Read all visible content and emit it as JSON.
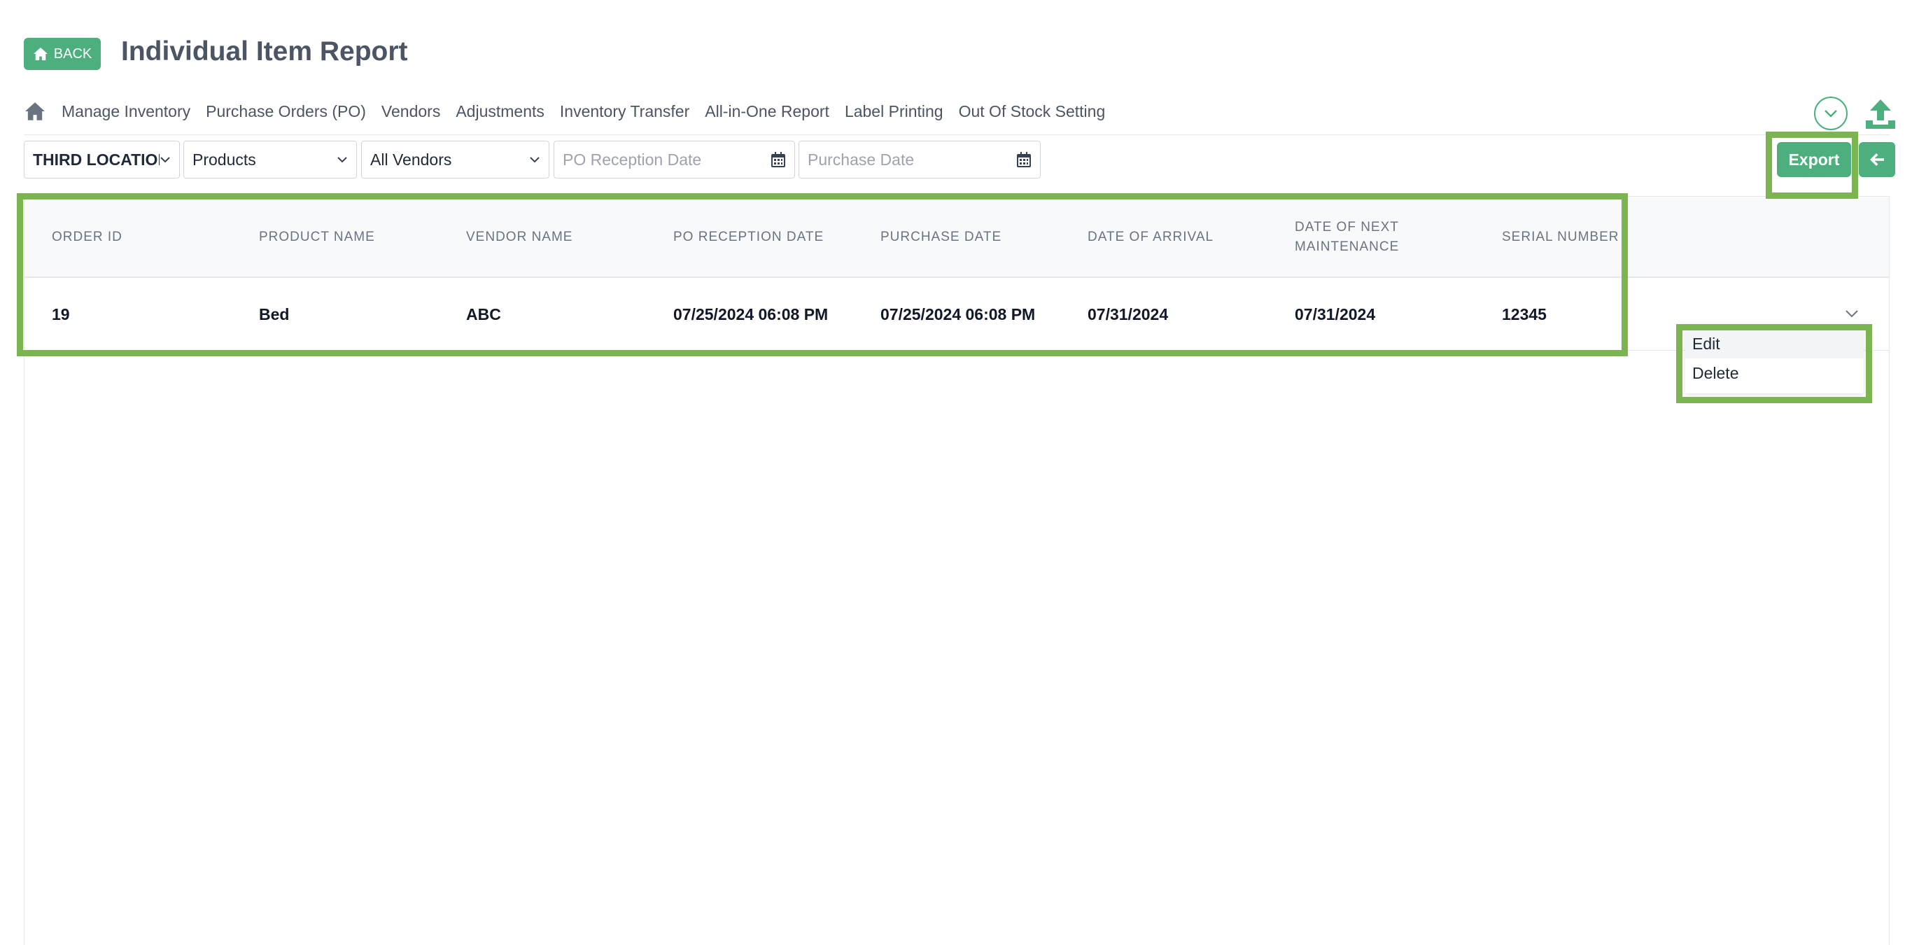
{
  "header": {
    "back_label": "BACK",
    "title": "Individual Item Report"
  },
  "nav": {
    "items": [
      "Manage Inventory",
      "Purchase Orders (PO)",
      "Vendors",
      "Adjustments",
      "Inventory Transfer",
      "All-in-One Report",
      "Label Printing",
      "Out Of Stock Setting"
    ]
  },
  "filters": {
    "location": "THIRD LOCATION",
    "product": "Products",
    "vendor": "All Vendors",
    "po_reception_date_placeholder": "PO Reception Date",
    "purchase_date_placeholder": "Purchase Date"
  },
  "toolbar": {
    "export_label": "Export"
  },
  "table": {
    "columns": [
      "ORDER ID",
      "PRODUCT NAME",
      "VENDOR NAME",
      "PO RECEPTION DATE",
      "PURCHASE DATE",
      "DATE OF ARRIVAL",
      "DATE OF NEXT MAINTENANCE",
      "SERIAL NUMBER"
    ],
    "rows": [
      [
        "19",
        "Bed",
        "ABC",
        "07/25/2024 06:08 PM",
        "07/25/2024 06:08 PM",
        "07/31/2024",
        "07/31/2024",
        "12345"
      ]
    ]
  },
  "row_menu": {
    "items": [
      "Edit",
      "Delete"
    ]
  },
  "colors": {
    "accent": "#4caf7d",
    "highlight": "#7cb451"
  }
}
